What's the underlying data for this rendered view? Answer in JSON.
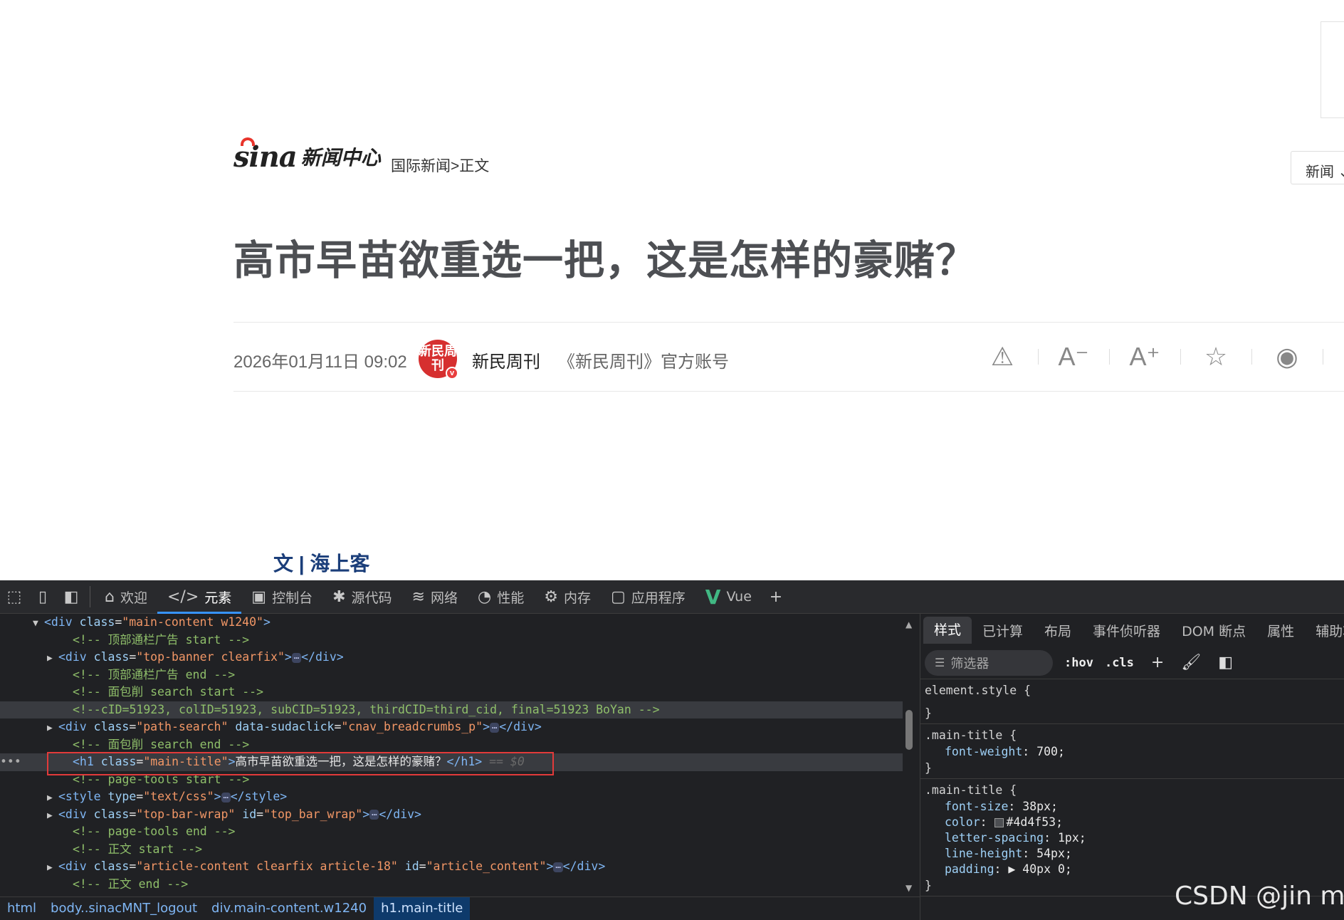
{
  "page": {
    "logo_brand": "sina",
    "logo_site": "新闻中心",
    "breadcrumb": "国际新闻>正文",
    "channel_select": "新闻 ⌄",
    "main_title": "高市早苗欲重选一把，这是怎样的豪赌？",
    "pub_date": "2026年01月11日 09:02",
    "media_logo_text": "新民周刊",
    "media_logo_badge": "v",
    "source": "新民周刊",
    "account": "《新民周刊》官方账号",
    "author": "文 | 海上客",
    "tools": [
      {
        "icon": "warning-icon",
        "glyph": "⚠"
      },
      {
        "icon": "font-decrease-icon",
        "glyph": "A⁻"
      },
      {
        "icon": "font-increase-icon",
        "glyph": "A⁺"
      },
      {
        "icon": "star-icon",
        "glyph": "☆"
      },
      {
        "icon": "weibo-icon",
        "glyph": "◉"
      },
      {
        "icon": "comment-icon",
        "glyph": "◌"
      }
    ]
  },
  "devtools": {
    "toolbar": {
      "inspect_icon": "⬚",
      "device_icon": "▯",
      "dock_icon": "◧",
      "tabs": [
        {
          "label": "欢迎",
          "icon": "home-icon",
          "glyph": "⌂"
        },
        {
          "label": "元素",
          "icon": "code-icon",
          "glyph": "</>"
        },
        {
          "label": "控制台",
          "icon": "console-icon",
          "glyph": "▣"
        },
        {
          "label": "源代码",
          "icon": "bug-icon",
          "glyph": "✱"
        },
        {
          "label": "网络",
          "icon": "wifi-icon",
          "glyph": "≋"
        },
        {
          "label": "性能",
          "icon": "gauge-icon",
          "glyph": "◔"
        },
        {
          "label": "内存",
          "icon": "memory-icon",
          "glyph": "⚙"
        },
        {
          "label": "应用程序",
          "icon": "app-icon",
          "glyph": "▢"
        },
        {
          "label": "Vue",
          "icon": "vue-icon",
          "glyph": "V"
        }
      ],
      "add_tab": "+"
    },
    "dom_lines": [
      {
        "indent": 2,
        "arrow": "▼",
        "parts": [
          [
            "tag",
            "<div "
          ],
          [
            "attr",
            "class"
          ],
          [
            "txt",
            "="
          ],
          [
            "val",
            "\"main-content w1240\""
          ],
          [
            "tag",
            ">"
          ]
        ]
      },
      {
        "indent": 4,
        "arrow": "",
        "parts": [
          [
            "cm",
            "<!-- 顶部通栏广告 start -->"
          ]
        ]
      },
      {
        "indent": 3,
        "arrow": "▶",
        "parts": [
          [
            "tag",
            "<div "
          ],
          [
            "attr",
            "class"
          ],
          [
            "txt",
            "="
          ],
          [
            "val",
            "\"top-banner clearfix\""
          ],
          [
            "tag",
            ">"
          ],
          [
            "ell",
            "⋯"
          ],
          [
            "tag",
            "</div>"
          ]
        ]
      },
      {
        "indent": 4,
        "arrow": "",
        "parts": [
          [
            "cm",
            "<!-- 顶部通栏广告 end -->"
          ]
        ]
      },
      {
        "indent": 4,
        "arrow": "",
        "parts": [
          [
            "cm",
            "<!-- 面包削 search start -->"
          ]
        ]
      },
      {
        "indent": 4,
        "arrow": "",
        "hl": true,
        "parts": [
          [
            "cm",
            "<!--cID=51923, colID=51923, subCID=51923, thirdCID=third_cid, final=51923 BoYan -->"
          ]
        ]
      },
      {
        "indent": 3,
        "arrow": "▶",
        "parts": [
          [
            "tag",
            "<div "
          ],
          [
            "attr",
            "class"
          ],
          [
            "txt",
            "="
          ],
          [
            "val",
            "\"path-search\""
          ],
          [
            "txt",
            " "
          ],
          [
            "attr",
            "data-sudaclick"
          ],
          [
            "txt",
            "="
          ],
          [
            "val",
            "\"cnav_breadcrumbs_p\""
          ],
          [
            "tag",
            ">"
          ],
          [
            "ell",
            "⋯"
          ],
          [
            "tag",
            "</div>"
          ]
        ]
      },
      {
        "indent": 4,
        "arrow": "",
        "parts": [
          [
            "cm",
            "<!-- 面包削 search end -->"
          ]
        ]
      },
      {
        "indent": 4,
        "arrow": "",
        "hl": true,
        "dots": "•••",
        "parts": [
          [
            "tag",
            "<h1 "
          ],
          [
            "attr",
            "class"
          ],
          [
            "txt",
            "="
          ],
          [
            "val",
            "\"main-title\""
          ],
          [
            "tag",
            ">"
          ],
          [
            "txt",
            "高市早苗欲重选一把，这是怎样的豪赌？"
          ],
          [
            "tag",
            "</h1>"
          ],
          [
            "dim",
            " == $0"
          ]
        ]
      },
      {
        "indent": 4,
        "arrow": "",
        "parts": [
          [
            "cm",
            "<!-- page-tools start -->"
          ]
        ]
      },
      {
        "indent": 3,
        "arrow": "▶",
        "parts": [
          [
            "tag",
            "<style "
          ],
          [
            "attr",
            "type"
          ],
          [
            "txt",
            "="
          ],
          [
            "val",
            "\"text/css\""
          ],
          [
            "tag",
            ">"
          ],
          [
            "ell",
            "⋯"
          ],
          [
            "tag",
            "</style>"
          ]
        ]
      },
      {
        "indent": 3,
        "arrow": "▶",
        "parts": [
          [
            "tag",
            "<div "
          ],
          [
            "attr",
            "class"
          ],
          [
            "txt",
            "="
          ],
          [
            "val",
            "\"top-bar-wrap\""
          ],
          [
            "txt",
            " "
          ],
          [
            "attr",
            "id"
          ],
          [
            "txt",
            "="
          ],
          [
            "val",
            "\"top_bar_wrap\""
          ],
          [
            "tag",
            ">"
          ],
          [
            "ell",
            "⋯"
          ],
          [
            "tag",
            "</div>"
          ]
        ]
      },
      {
        "indent": 4,
        "arrow": "",
        "parts": [
          [
            "cm",
            "<!-- page-tools end -->"
          ]
        ]
      },
      {
        "indent": 4,
        "arrow": "",
        "parts": [
          [
            "cm",
            "<!-- 正文 start -->"
          ]
        ]
      },
      {
        "indent": 3,
        "arrow": "▶",
        "parts": [
          [
            "tag",
            "<div "
          ],
          [
            "attr",
            "class"
          ],
          [
            "txt",
            "="
          ],
          [
            "val",
            "\"article-content clearfix article-18\""
          ],
          [
            "txt",
            " "
          ],
          [
            "attr",
            "id"
          ],
          [
            "txt",
            "="
          ],
          [
            "val",
            "\"article_content\""
          ],
          [
            "tag",
            ">"
          ],
          [
            "ell",
            "⋯"
          ],
          [
            "tag",
            "</div>"
          ]
        ]
      },
      {
        "indent": 4,
        "arrow": "",
        "parts": [
          [
            "cm",
            "<!-- 正文 end -->"
          ]
        ]
      }
    ],
    "breadcrumbs": [
      "html",
      "body..sinacMNT_logout",
      "div.main-content.w1240",
      "h1.main-title"
    ],
    "styles": {
      "tabs": [
        "样式",
        "已计算",
        "布局",
        "事件侦听器",
        "DOM 断点",
        "属性",
        "辅助功能"
      ],
      "filter_placeholder": "筛选器",
      "hov": ":hov",
      "cls": ".cls",
      "rules": [
        {
          "selector": "element.style {",
          "decls": [],
          "close": "}"
        },
        {
          "selector": ".main-title {",
          "decls": [
            {
              "name": "font-weight",
              "value": "700;"
            }
          ],
          "close": "}"
        },
        {
          "selector": ".main-title {",
          "decls": [
            {
              "name": "font-size",
              "value": "38px;"
            },
            {
              "name": "color",
              "value": "#4d4f53;",
              "swatch": "#4d4f53"
            },
            {
              "name": "letter-spacing",
              "value": "1px;"
            },
            {
              "name": "line-height",
              "value": "54px;"
            },
            {
              "name": "padding",
              "value": "▶ 40px 0;"
            }
          ],
          "close": "}"
        }
      ]
    },
    "watermark": "CSDN @jin mo"
  }
}
